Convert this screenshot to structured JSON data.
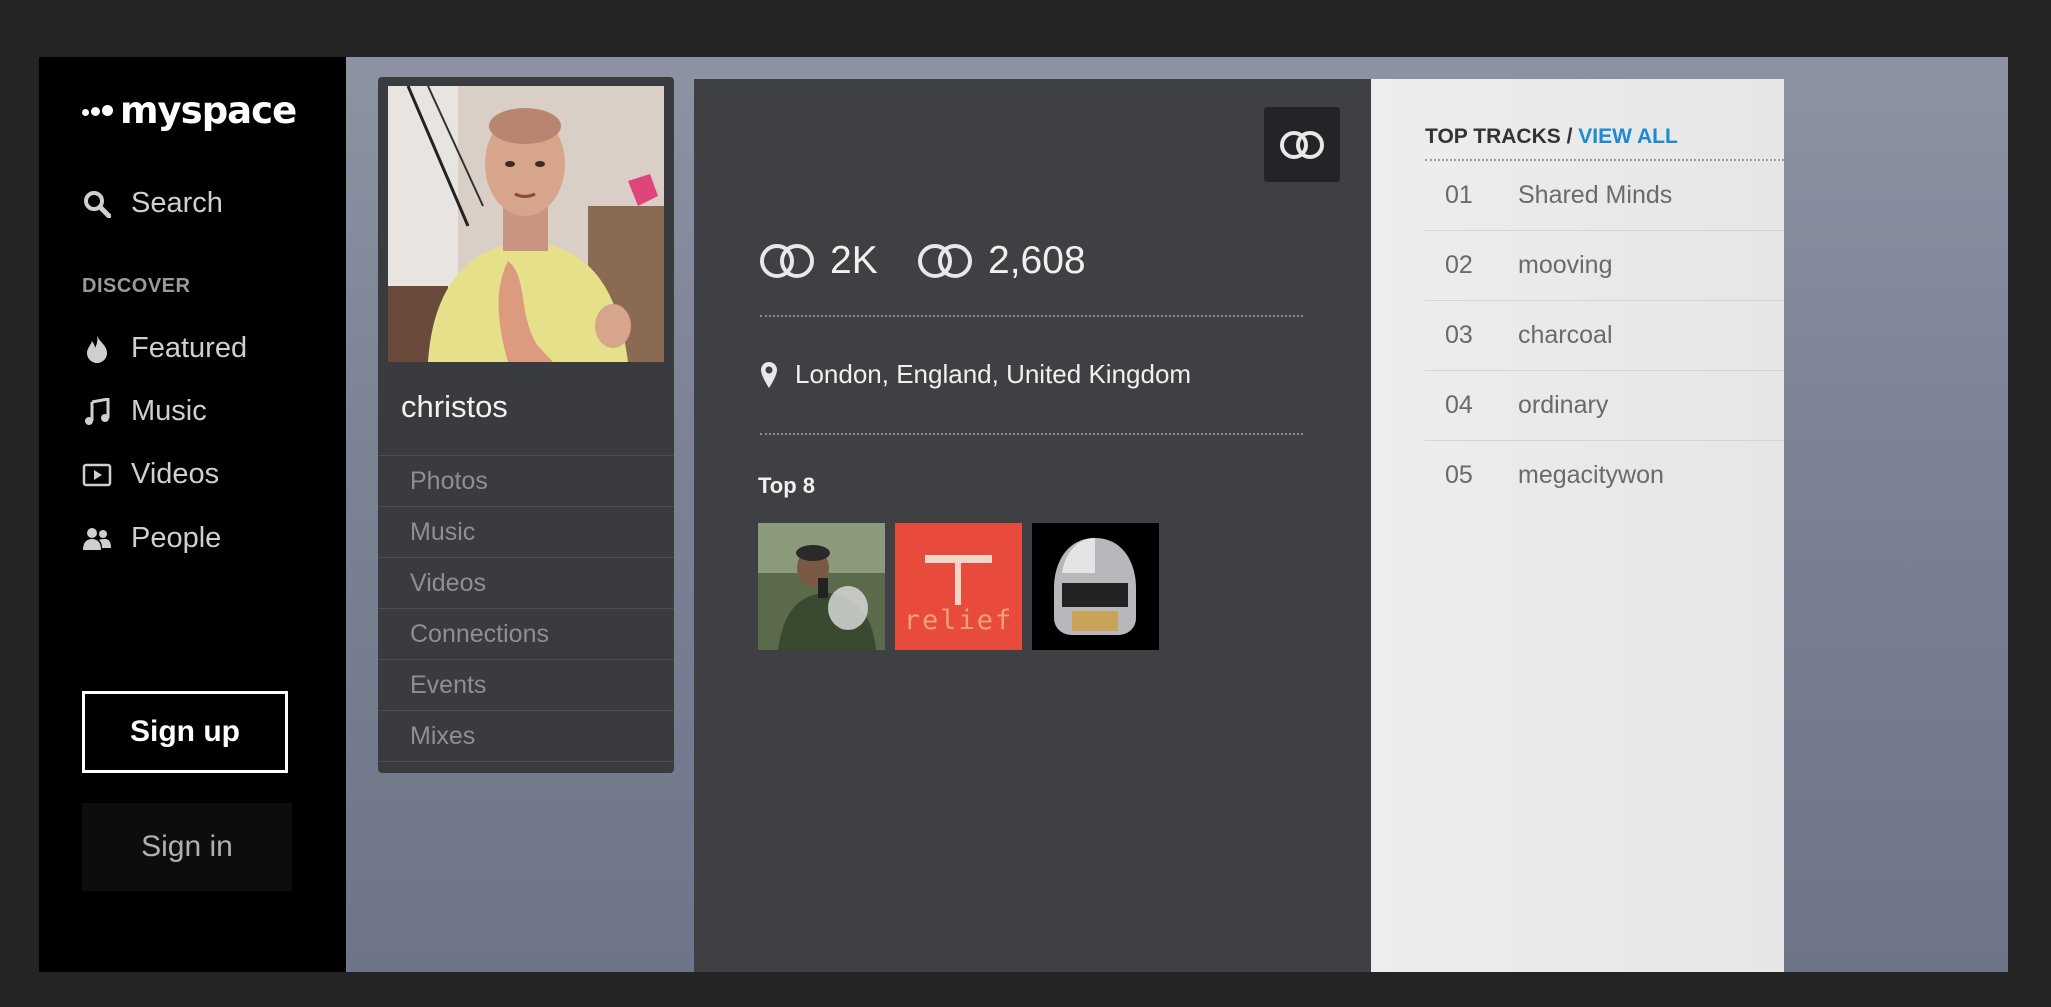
{
  "brand": {
    "logo_text": "myspace"
  },
  "sidebar": {
    "search_label": "Search",
    "discover_label": "DISCOVER",
    "items": [
      {
        "label": "Featured",
        "icon": "flame-icon"
      },
      {
        "label": "Music",
        "icon": "music-note-icon"
      },
      {
        "label": "Videos",
        "icon": "video-icon"
      },
      {
        "label": "People",
        "icon": "people-icon"
      }
    ],
    "signup_label": "Sign up",
    "signin_label": "Sign in"
  },
  "profile": {
    "name": "christos",
    "links": [
      "Photos",
      "Music",
      "Videos",
      "Connections",
      "Events",
      "Mixes"
    ]
  },
  "stats": {
    "connections_in": "2K",
    "connections_out": "2,608"
  },
  "location": "London, England, United Kingdom",
  "top8": {
    "label": "Top 8",
    "thumb_text": "relief"
  },
  "tracks": {
    "header": "TOP TRACKS",
    "separator": " / ",
    "view_all": "VIEW ALL",
    "items": [
      {
        "num": "01",
        "title": "Shared Minds"
      },
      {
        "num": "02",
        "title": "mooving"
      },
      {
        "num": "03",
        "title": "charcoal"
      },
      {
        "num": "04",
        "title": "ordinary"
      },
      {
        "num": "05",
        "title": "megacitywon"
      }
    ]
  },
  "colors": {
    "accent_link": "#1c8ad0",
    "panel_dark": "#3f4044",
    "sidebar_bg": "#000000"
  }
}
